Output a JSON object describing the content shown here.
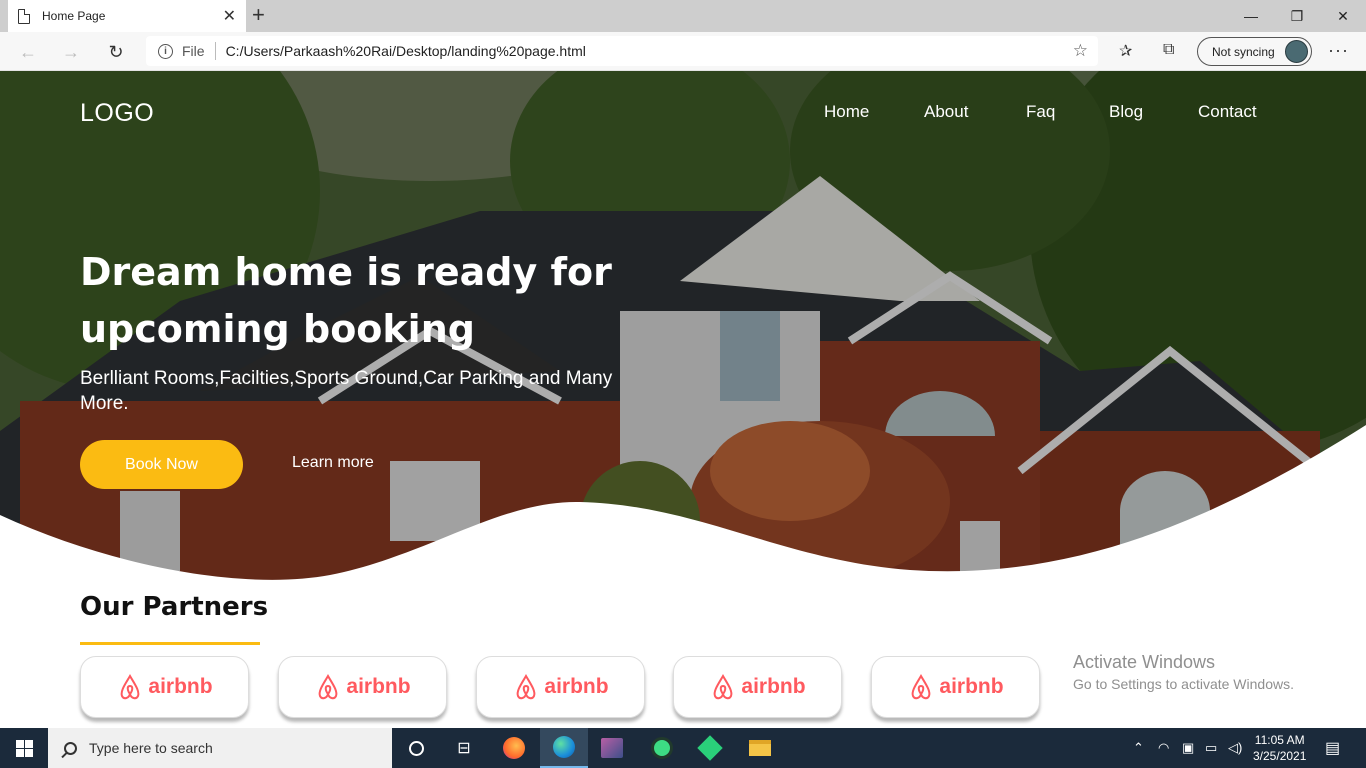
{
  "browser": {
    "tab_title": "Home Page",
    "tab_close": "✕",
    "new_tab": "+",
    "window_buttons": [
      "—",
      "❐",
      "✕"
    ],
    "address_prefix": "File",
    "address": "C:/Users/Parkaash%20Rai/Desktop/landing%20page.html",
    "sync_label": "Not syncing",
    "more": "···"
  },
  "page": {
    "logo": "LOGO",
    "nav": [
      "Home",
      "About",
      "Faq",
      "Blog",
      "Contact"
    ],
    "headline_line1": "Dream home is ready for",
    "headline_line2": "upcoming booking",
    "subline": "Berlliant Rooms,Facilties,Sports Ground,Car Parking and Many More.",
    "book_button": "Book Now",
    "learn_more": "Learn more",
    "partners_title": "Our Partners",
    "partners": [
      "airbnb",
      "airbnb",
      "airbnb",
      "airbnb",
      "airbnb"
    ],
    "accent_color": "#fbbb12",
    "partner_color": "#ff5a5f"
  },
  "watermark": {
    "line1": "Activate Windows",
    "line2": "Go to Settings to activate Windows."
  },
  "taskbar": {
    "search_placeholder": "Type here to search",
    "time": "11:05 AM",
    "date": "3/25/2021"
  }
}
